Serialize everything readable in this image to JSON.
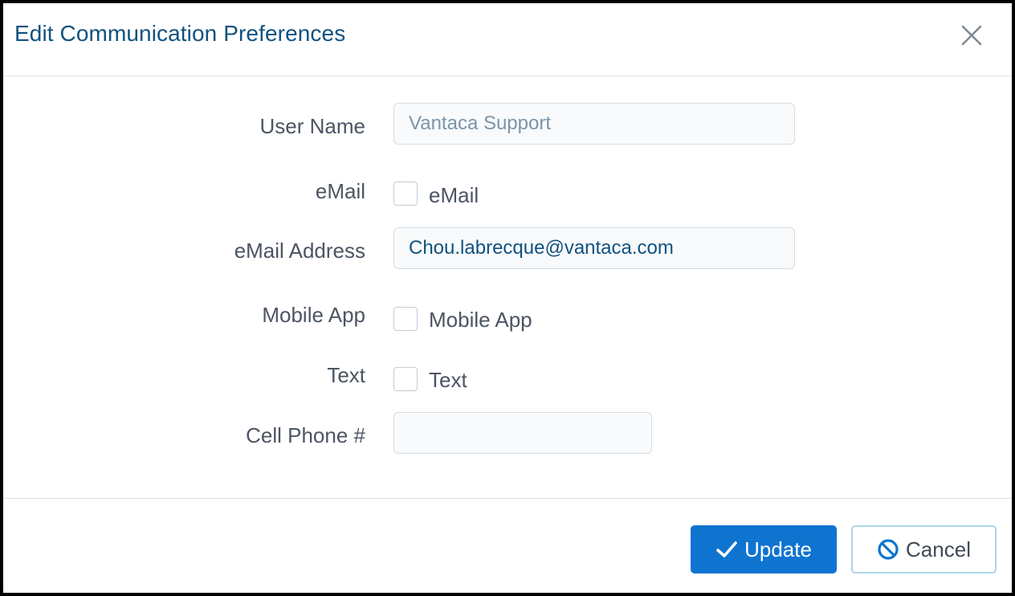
{
  "dialog": {
    "title": "Edit Communication Preferences",
    "close_icon": "close-icon"
  },
  "form": {
    "user_name": {
      "label": "User Name",
      "value": "Vantaca Support"
    },
    "email_pref": {
      "label": "eMail",
      "checkbox_label": "eMail",
      "checked": false
    },
    "email_address": {
      "label": "eMail Address",
      "value": "Chou.labrecque@vantaca.com"
    },
    "mobile_app": {
      "label": "Mobile App",
      "checkbox_label": "Mobile App",
      "checked": false
    },
    "text": {
      "label": "Text",
      "checkbox_label": "Text",
      "checked": false
    },
    "cell_phone": {
      "label": "Cell Phone #",
      "value": ""
    }
  },
  "footer": {
    "update_label": "Update",
    "update_icon": "checkmark-icon",
    "cancel_label": "Cancel",
    "cancel_icon": "ban-icon"
  },
  "colors": {
    "title": "#10527f",
    "primary": "#0f74d0",
    "cancel_border": "#a9d6e8"
  }
}
